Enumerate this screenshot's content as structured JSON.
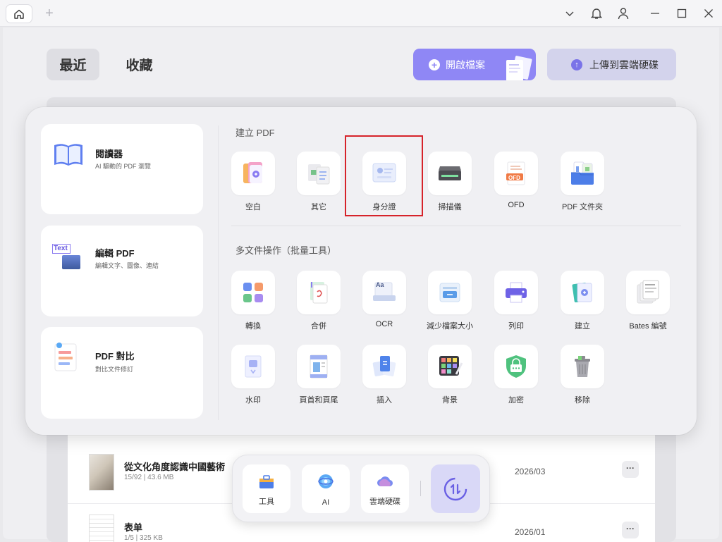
{
  "titlebar": {
    "home_icon": "home-icon",
    "new_tab": "+"
  },
  "header": {
    "tab_recent": "最近",
    "tab_favorites": "收藏",
    "open_file": "開啟檔案",
    "upload_cloud": "上傳到雲端硬碟"
  },
  "panel": {
    "left_cards": [
      {
        "title": "閱讀器",
        "subtitle": "AI 驅動的 PDF 瀏覽"
      },
      {
        "title": "編輯 PDF",
        "subtitle": "編輯文字、圖像、連結",
        "icon_text": "Text"
      },
      {
        "title": "PDF 對比",
        "subtitle": "對比文件修訂"
      }
    ],
    "create_title": "建立 PDF",
    "create_tools": [
      "空白",
      "其它",
      "身分證",
      "掃描儀",
      "OFD",
      "PDF 文件夾"
    ],
    "ofd_icon_text": "OFD",
    "ocr_icon_text": "Aa",
    "batch_title": "多文件操作（批量工具）",
    "batch_tools_row1": [
      "轉換",
      "合併",
      "OCR",
      "減少檔案大小",
      "列印",
      "建立",
      "Bates 編號"
    ],
    "batch_tools_row2": [
      "水印",
      "頁首和頁尾",
      "插入",
      "背景",
      "加密",
      "移除"
    ]
  },
  "files": [
    {
      "name": "從文化角度認識中國藝術",
      "meta": "15/92 | 43.6 MB",
      "date": "2026/03",
      "more": "···"
    },
    {
      "name": "表单",
      "meta": "1/5 | 325 KB",
      "date": "2026/01",
      "more": "···"
    }
  ],
  "dock": {
    "tools": "工具",
    "ai": "AI",
    "cloud": "雲端硬碟"
  },
  "colors": {
    "accent": "#8f87f5",
    "highlight": "#d6232a"
  }
}
